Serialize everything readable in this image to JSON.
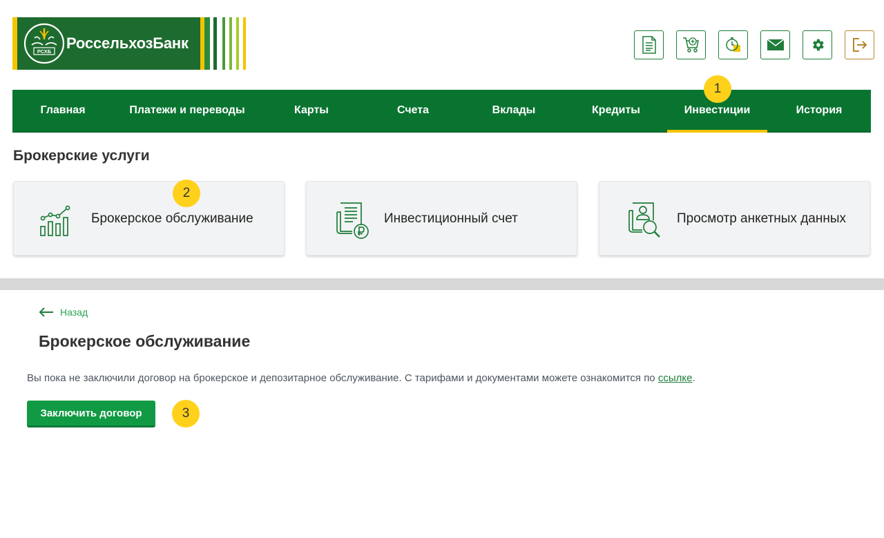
{
  "brand": {
    "name": "РоссельхозБанк",
    "emblem_text": "РСХБ"
  },
  "top_icons": [
    {
      "icon": "document-icon"
    },
    {
      "icon": "cart-icon"
    },
    {
      "icon": "timer-icon"
    },
    {
      "icon": "mail-icon"
    },
    {
      "icon": "gear-icon"
    },
    {
      "icon": "logout-icon"
    }
  ],
  "nav": {
    "items": [
      {
        "label": "Главная"
      },
      {
        "label": "Платежи и переводы"
      },
      {
        "label": "Карты"
      },
      {
        "label": "Счета"
      },
      {
        "label": "Вклады"
      },
      {
        "label": "Кредиты"
      },
      {
        "label": "Инвестиции",
        "active": true
      },
      {
        "label": "История"
      }
    ]
  },
  "markers": [
    "1",
    "2",
    "3"
  ],
  "section": {
    "title": "Брокерские услуги",
    "cards": [
      {
        "label": "Брокерское обслуживание",
        "icon": "chart-growth-icon"
      },
      {
        "label": "Инвестиционный счет",
        "icon": "ruble-document-icon"
      },
      {
        "label": "Просмотр анкетных данных",
        "icon": "profile-search-icon"
      }
    ]
  },
  "back_label": "Назад",
  "page_title": "Брокерское обслуживание",
  "info": {
    "text": "Вы пока не заключили договор на брокерское и депозитарное обслуживание. С тарифами и документами можете ознакомится по ",
    "link": "ссылке",
    "suffix": "."
  },
  "cta_label": "Заключить договор",
  "colors": {
    "brand_green": "#097430",
    "button_green": "#119a44",
    "accent_yellow": "#f5c400",
    "marker_yellow": "#ffd11a",
    "link_green": "#2aa451"
  }
}
